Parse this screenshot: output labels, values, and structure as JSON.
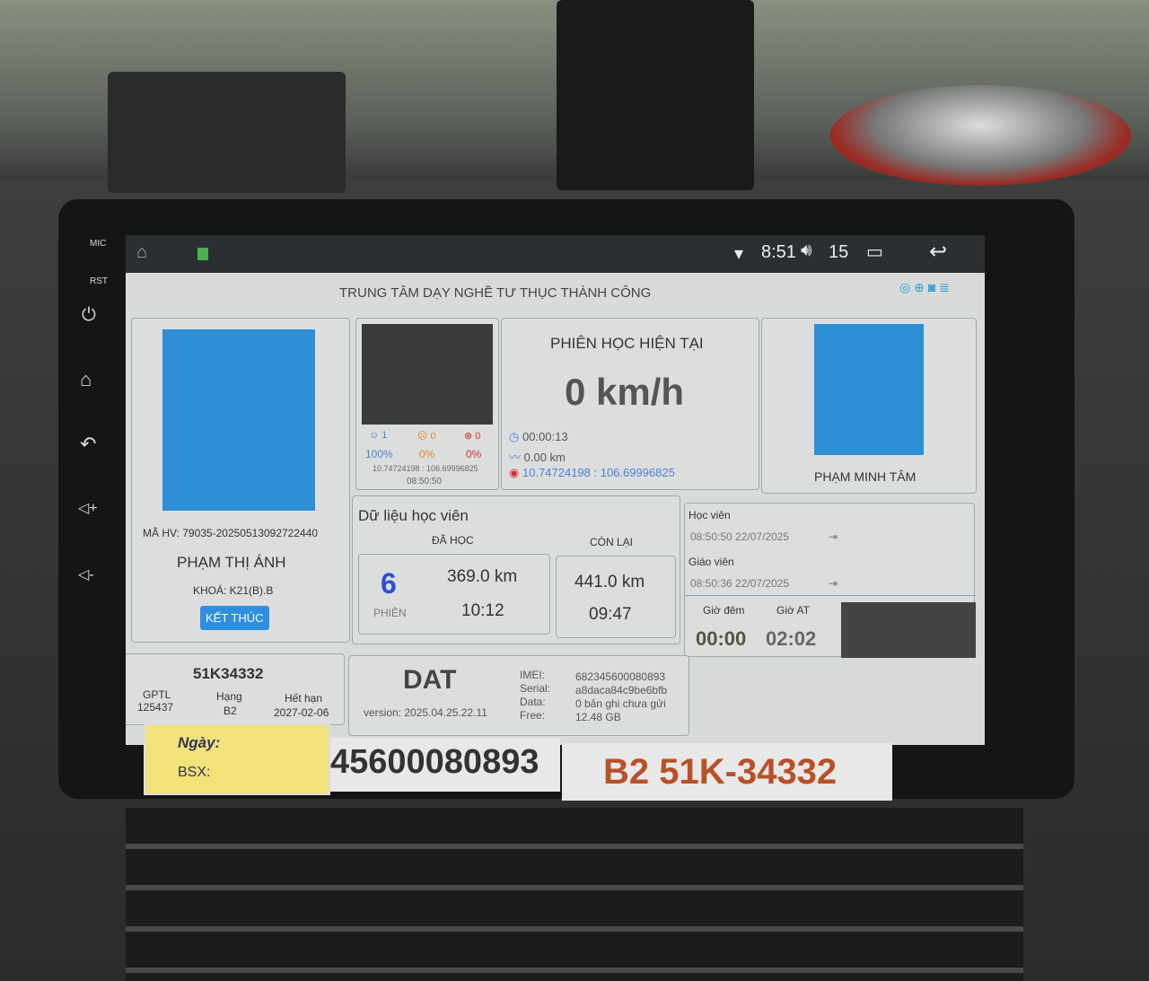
{
  "device": {
    "mic_label": "MIC",
    "rst_label": "RST"
  },
  "status_bar": {
    "time": "8:51",
    "volume": "15"
  },
  "app": {
    "title": "TRUNG TÂM DẠY NGHỀ TƯ THỤC THÀNH CÔNG",
    "student": {
      "id": "MÃ HV: 79035-20250513092722440",
      "name": "PHẠM THỊ ÁNH",
      "course": "KHOÁ: K21(B).B",
      "end_button": "KẾT THÚC"
    },
    "face_check": {
      "ok_count": "1",
      "warn_count": "0",
      "fail_count": "0",
      "ok_pct": "100%",
      "warn_pct": "0%",
      "fail_pct": "0%",
      "coords": "10.74724198 : 106.69996825",
      "time": "08:50:50"
    },
    "session": {
      "title": "PHIÊN HỌC HIỆN TẠI",
      "speed": "0 km/h",
      "duration": "00:00:13",
      "distance": "0.00 km",
      "coords": "10.74724198 : 106.69996825"
    },
    "teacher": {
      "name": "PHẠM MINH TÂM"
    },
    "student_data": {
      "title": "Dữ liệu học viên",
      "learned_label": "ĐÃ HỌC",
      "remaining_label": "CÒN LẠI",
      "sessions": "6",
      "sessions_label": "PHIÊN",
      "learned_km": "369.0 km",
      "learned_time": "10:12",
      "remaining_km": "441.0 km",
      "remaining_time": "09:47"
    },
    "log": {
      "student_label": "Học viên",
      "student_login": "08:50:50 22/07/2025",
      "teacher_label": "Giáo viên",
      "teacher_login": "08:50:36 22/07/2025",
      "night_label": "Giờ đêm",
      "night_value": "00:00",
      "auto_label": "Giờ AT",
      "auto_value": "02:02"
    },
    "vehicle": {
      "plate": "51K34332",
      "gptl_label": "GPTL",
      "gptl": "125437",
      "class_label": "Hạng",
      "class": "B2",
      "expiry_label": "Hết hạn",
      "expiry": "2027-02-06"
    },
    "device_info": {
      "brand": "DAT",
      "version": "version: 2025.04.25.22.11",
      "imei_label": "IMEI:",
      "imei": "682345600080893",
      "serial_label": "Serial:",
      "serial": "a8daca84c9be6bfb",
      "data_label": "Data:",
      "data": "0 bản ghi chưa gửi",
      "free_label": "Free:",
      "free": "12.48 GB"
    }
  },
  "stickers": {
    "date_label": "Ngày:",
    "bsx_label": "BSX:",
    "imei_partial": "45600080893",
    "plate": "B2 51K-34332"
  },
  "colors": {
    "accent": "#2e8fe0",
    "ok": "#4a7fd6",
    "warn": "#e08a2a",
    "fail": "#d83030"
  }
}
